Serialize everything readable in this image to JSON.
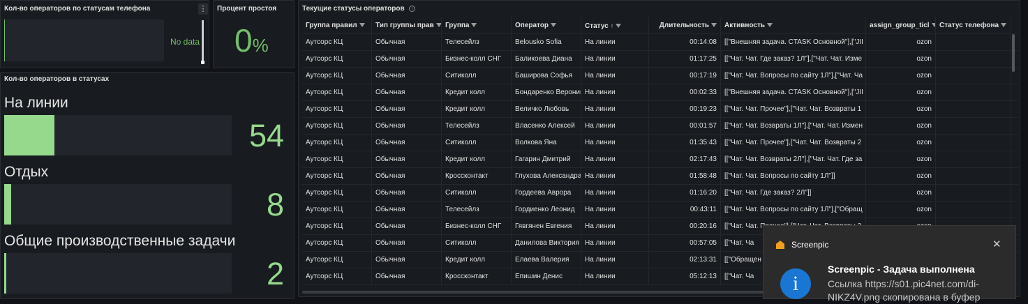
{
  "panel_phone_status": {
    "title": "Кол-во операторов по статусам телефона",
    "no_data": "No data",
    "menu": "⋮"
  },
  "panel_idle": {
    "title": "Процент простоя",
    "value": "0",
    "unit": "%"
  },
  "panel_statuses": {
    "title": "Кол-во операторов в статусах",
    "items": [
      {
        "label": "На линии",
        "value": "54",
        "fill_fraction": 0.22
      },
      {
        "label": "Отдых",
        "value": "8",
        "fill_fraction": 0.03
      },
      {
        "label": "Общие производственные задачи",
        "value": "2",
        "fill_fraction": 0.008
      }
    ],
    "fill_color": "#96d98d"
  },
  "panel_table": {
    "title": "Текущие статусы операторов",
    "info": "i",
    "columns": [
      "Группа правил",
      "Тип группы прав",
      "Группа",
      "Оператор",
      "Статус",
      "Длительность",
      "Активность",
      "assign_group_ticl",
      "Статус телефона"
    ],
    "sort_indicator": "↑",
    "rows": [
      [
        "Аутсорс КЦ",
        "Обычная",
        "Телесейлз",
        "Belousko Sofia",
        "На линии",
        "00:14:08",
        "[[\"Внешняя задача. CTASK Основной\"],[\"JII",
        "ozon",
        ""
      ],
      [
        "Аутсорс КЦ",
        "Обычная",
        "Бизнес-колл СНГ",
        "Баликоева Диана",
        "На линии",
        "01:17:25",
        "[[\"Чат. Чат. Где заказ? 1Л\"],[\"Чат. Чат. Изме",
        "ozon",
        ""
      ],
      [
        "Аутсорс КЦ",
        "Обычная",
        "Ситиколл",
        "Баширова Софья",
        "На линии",
        "00:17:19",
        "[[\"Чат. Чат. Вопросы по сайту 1Л\"],[\"Чат. Ча",
        "ozon",
        ""
      ],
      [
        "Аутсорс КЦ",
        "Обычная",
        "Кредит колл",
        "Бондаренко Вероника",
        "На линии",
        "00:02:33",
        "[[\"Внешняя задача. CTASK Основной\"],[\"JII",
        "ozon",
        ""
      ],
      [
        "Аутсорс КЦ",
        "Обычная",
        "Кредит колл",
        "Величко Любовь",
        "На линии",
        "00:19:23",
        "[[\"Чат. Чат. Прочее\"],[\"Чат. Чат. Возвраты 1",
        "ozon",
        ""
      ],
      [
        "Аутсорс КЦ",
        "Обычная",
        "Телесейлз",
        "Власенко Алексей",
        "На линии",
        "00:01:57",
        "[[\"Чат. Чат. Возвраты 1Л\"],[\"Чат. Чат. Измен",
        "ozon",
        ""
      ],
      [
        "Аутсорс КЦ",
        "Обычная",
        "Ситиколл",
        "Волкова Яна",
        "На линии",
        "01:35:43",
        "[[\"Чат. Чат. Прочее\"],[\"Чат. Чат. Возвраты 2",
        "ozon",
        ""
      ],
      [
        "Аутсорс КЦ",
        "Обычная",
        "Кредит колл",
        "Гагарин Дмитрий",
        "На линии",
        "02:17:43",
        "[[\"Чат. Чат. Возвраты 2Л\"],[\"Чат. Чат. Где за",
        "ozon",
        ""
      ],
      [
        "Аутсорс КЦ",
        "Обычная",
        "Кроссконтакт",
        "Глухова Александра",
        "На линии",
        "01:58:48",
        "[[\"Чат. Чат. Вопросы по сайту 1Л\"]]",
        "ozon",
        ""
      ],
      [
        "Аутсорс КЦ",
        "Обычная",
        "Ситиколл",
        "Гордеева Аврора",
        "На линии",
        "01:16:20",
        "[[\"Чат. Чат. Где заказ? 2Л\"]]",
        "ozon",
        ""
      ],
      [
        "Аутсорс КЦ",
        "Обычная",
        "Телесейлз",
        "Гордиенко Леонид",
        "На линии",
        "00:43:11",
        "[[\"Чат. Чат. Вопросы по сайту 1Л\"],[\"Обращ",
        "ozon",
        ""
      ],
      [
        "Аутсорс КЦ",
        "Обычная",
        "Бизнес-колл СНГ",
        "Гявгянен Евгения",
        "На линии",
        "00:20:16",
        "[[\"Чат. Чат. Прочее\"],[\"Чат. Чат. Возвраты 2",
        "ozon",
        ""
      ],
      [
        "Аутсорс КЦ",
        "Обычная",
        "Ситиколл",
        "Данилова Виктория",
        "На линии",
        "00:57:05",
        "[[\"Чат. Ча",
        "ozon",
        ""
      ],
      [
        "Аутсорс КЦ",
        "Обычная",
        "Кредит колл",
        "Елаева Валерия",
        "На линии",
        "02:13:31",
        "[[\"Обращен",
        "ozon",
        ""
      ],
      [
        "Аутсорс КЦ",
        "Обычная",
        "Кроссконтакт",
        "Епишин Денис",
        "На линии",
        "05:12:13",
        "[[\"Чат. Ча",
        "ozon",
        ""
      ]
    ]
  },
  "toast": {
    "app": "Screenpic",
    "close": "✕",
    "icon": "i",
    "title": "Screenpic - Задача выполнена",
    "body": "Ссылка https://s01.pic4net.com/di-NIKZ4V.png скопирована в буфер"
  }
}
